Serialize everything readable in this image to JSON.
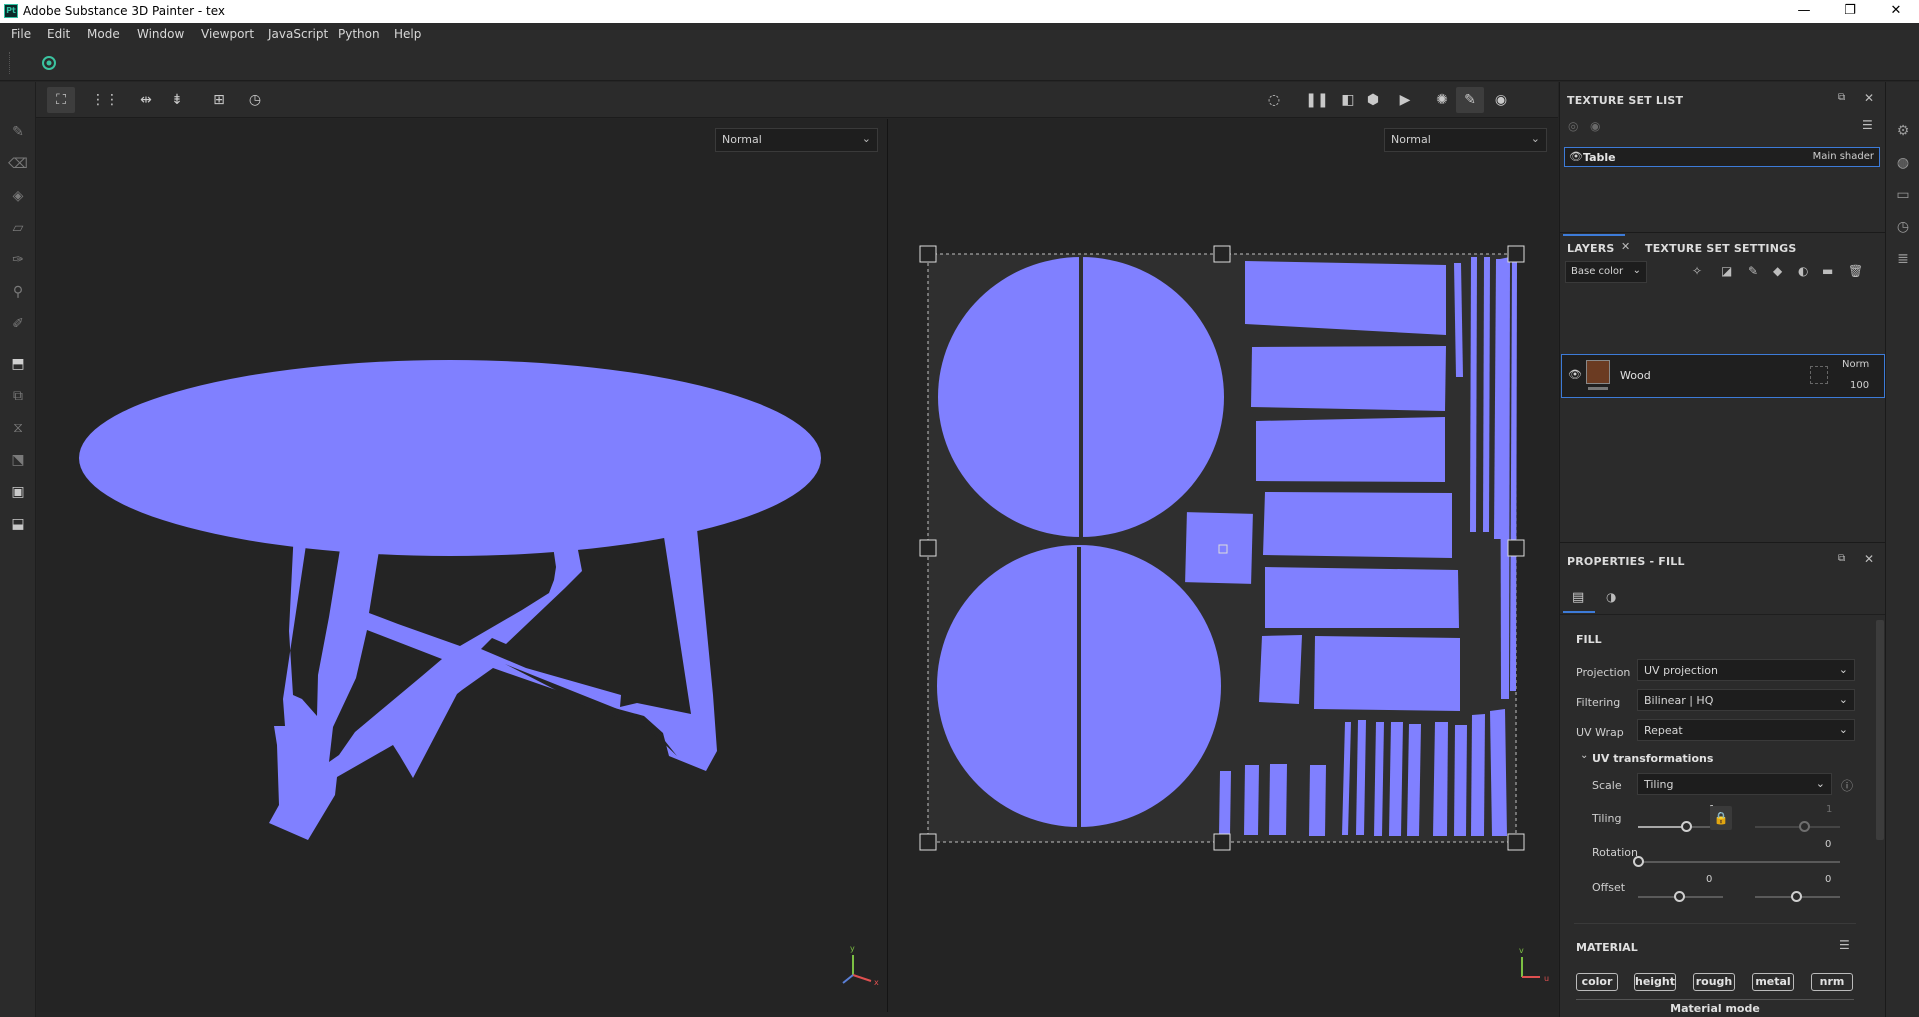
{
  "app": {
    "title": "Adobe Substance 3D Painter - tex",
    "logo_text": "Pt"
  },
  "window_controls": {
    "minimize": "—",
    "maximize": "❐",
    "close": "✕"
  },
  "menu": [
    "File",
    "Edit",
    "Mode",
    "Window",
    "Viewport",
    "JavaScript",
    "Python",
    "Help"
  ],
  "viewports": {
    "left_mode": "Normal",
    "right_mode": "Normal",
    "axis_x": "x",
    "axis_y": "y",
    "axis_u": "u",
    "axis_v": "v",
    "mesh_color": "#8080ff"
  },
  "texture_set_list": {
    "title": "TEXTURE SET LIST",
    "items": [
      {
        "name": "Table",
        "shader": "Main shader"
      }
    ]
  },
  "layers": {
    "tab_layers": "LAYERS",
    "tab_settings": "TEXTURE SET SETTINGS",
    "channel": "Base color",
    "items": [
      {
        "name": "Wood",
        "blend": "Norm",
        "opacity": "100"
      }
    ]
  },
  "properties": {
    "title": "PROPERTIES - FILL",
    "section": "FILL",
    "projection_label": "Projection",
    "projection_value": "UV projection",
    "filtering_label": "Filtering",
    "filtering_value": "Bilinear | HQ",
    "uvwrap_label": "UV Wrap",
    "uvwrap_value": "Repeat",
    "uv_transforms_label": "UV transformations",
    "scale_label": "Scale",
    "scale_value": "Tiling",
    "tiling_label": "Tiling",
    "tiling_u": "1",
    "tiling_v": "1",
    "rotation_label": "Rotation",
    "rotation_value": "0",
    "offset_label": "Offset",
    "offset_u": "0",
    "offset_v": "0",
    "material_section": "MATERIAL",
    "material_buttons": [
      "color",
      "height",
      "rough",
      "metal",
      "nrm"
    ],
    "material_mode_label": "Material mode"
  },
  "icons": {
    "eye": "eye-icon",
    "lock": "lock-icon",
    "info": "info-icon"
  }
}
